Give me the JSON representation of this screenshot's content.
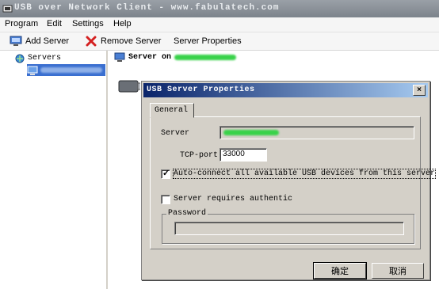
{
  "window": {
    "title": "USB over Network Client - www.fabulatech.com"
  },
  "menu": {
    "items": [
      "Program",
      "Edit",
      "Settings",
      "Help"
    ]
  },
  "toolbar": {
    "add_server": "Add Server",
    "remove_server": "Remove Server",
    "server_properties": "Server Properties"
  },
  "tree": {
    "root_label": "Servers"
  },
  "detail": {
    "header_prefix": "Server on"
  },
  "dialog": {
    "title": "USB Server Properties",
    "close_label": "×",
    "tab_general": "General",
    "server_label": "Server",
    "tcp_port_label": "TCP-port",
    "tcp_port_value": "33000",
    "auto_connect_label": "Auto-connect all available USB devices from this server",
    "auto_connect_checked": true,
    "auth_label": "Server requires authentic",
    "auth_checked": false,
    "password_label": "Password",
    "password_value": "",
    "ok_label": "确定",
    "cancel_label": "取消"
  },
  "colors": {
    "titlebar": "#7c838b",
    "selection": "#3a6fd0",
    "dialog_title_start": "#0a246a",
    "dialog_title_end": "#a6caf0",
    "redaction": "#39d24a"
  }
}
